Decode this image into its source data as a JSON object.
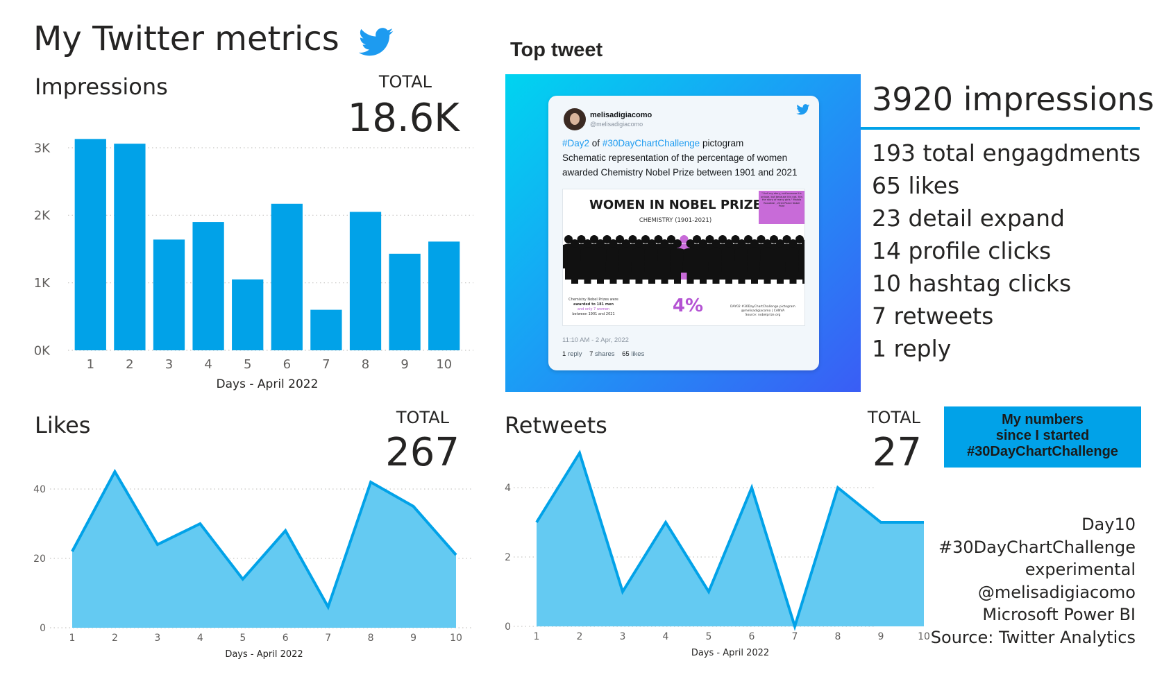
{
  "page": {
    "title": "My Twitter metrics",
    "icon": "twitter-bird-icon",
    "accent_color": "#01A2E8",
    "area_fill_color": "#64CAF2"
  },
  "impressions": {
    "title": "Impressions",
    "total_label": "TOTAL",
    "total_value": "18.6K"
  },
  "likes": {
    "title": "Likes",
    "total_label": "TOTAL",
    "total_value": "267"
  },
  "retweets": {
    "title": "Retweets",
    "total_label": "TOTAL",
    "total_value": "27"
  },
  "top_tweet": {
    "title": "Top tweet",
    "card": {
      "user": "melisadigiacomo",
      "handle": "@melisadigiacomo",
      "tag_day": "#Day2",
      "of_text": "of",
      "tag_challenge": "#30DayChartChallenge",
      "text_after": "pictogram",
      "text_body": "Schematic representation of the percentage of women awarded Chemistry Nobel Prize between 1901 and 2021",
      "time": "11:10 AM - 2 Apr, 2022",
      "replies": "1",
      "replies_label": "reply",
      "shares": "7",
      "shares_label": "shares",
      "likes": "65",
      "likes_label": "likes",
      "image": {
        "title": "WOMEN IN NOBEL PRIZE",
        "subtitle": "CHEMISTRY (1901-2021)",
        "quote": "\"I tell my story, not because it's unique, but because it is not. It is the story of many girls.\" Malala Yousafzai , 2014 Peace Nobel Prize",
        "note_line1": "Chemistry Nobel Prizes were",
        "note_line2": "awarded to 181 men",
        "note_line3": "and only 7 women",
        "note_line4": "between 1901 and 2021",
        "percent": "4%",
        "credit_line1": "DAY02 #30DayChartChallenge pictogram",
        "credit_line2": "@melisadigiacomo | CANVA",
        "credit_line3": "Source: nobelprize.org"
      }
    },
    "headline": "3920 impressions",
    "metrics": [
      "193 total engagdments",
      "65 likes",
      "23 detail expand",
      "14 profile clicks",
      "10 hashtag clicks",
      "7 retweets",
      "1 reply"
    ]
  },
  "badge": {
    "line1": "My numbers",
    "line2": "since I started",
    "line3": "#30DayChartChallenge"
  },
  "credits": [
    "Day10",
    "#30DayChartChallenge",
    "experimental",
    "@melisadigiacomo",
    "Microsoft Power BI",
    "Source: Twitter Analytics"
  ],
  "chart_data": [
    {
      "type": "bar",
      "title": "Impressions",
      "categories": [
        "1",
        "2",
        "3",
        "4",
        "5",
        "6",
        "7",
        "8",
        "9",
        "10"
      ],
      "values": [
        3130,
        3060,
        1640,
        1900,
        1050,
        2170,
        600,
        2050,
        1430,
        1610
      ],
      "xlabel": "Days - April 2022",
      "ylabel": "",
      "ylim": [
        0,
        3000
      ],
      "yticks": [
        0,
        1000,
        2000,
        3000
      ],
      "ytick_labels": [
        "0K",
        "1K",
        "2K",
        "3K"
      ],
      "grid": true,
      "color": "#01A2E8"
    },
    {
      "type": "area",
      "title": "Likes",
      "categories": [
        "1",
        "2",
        "3",
        "4",
        "5",
        "6",
        "7",
        "8",
        "9",
        "10"
      ],
      "values": [
        22,
        45,
        24,
        30,
        14,
        28,
        6,
        42,
        35,
        21
      ],
      "xlabel": "Days - April 2022",
      "ylabel": "",
      "ylim": [
        0,
        40
      ],
      "yticks": [
        0,
        20,
        40
      ],
      "ytick_labels": [
        "0",
        "20",
        "40"
      ],
      "grid": true,
      "color": "#01A2E8"
    },
    {
      "type": "area",
      "title": "Retweets",
      "categories": [
        "1",
        "2",
        "3",
        "4",
        "5",
        "6",
        "7",
        "8",
        "9",
        "10"
      ],
      "values": [
        3,
        5,
        1,
        3,
        1,
        4,
        0,
        4,
        3,
        3
      ],
      "xlabel": "Days - April 2022",
      "ylabel": "",
      "ylim": [
        0,
        4
      ],
      "yticks": [
        0,
        2,
        4
      ],
      "ytick_labels": [
        "0",
        "2",
        "4"
      ],
      "grid": true,
      "color": "#01A2E8"
    }
  ]
}
